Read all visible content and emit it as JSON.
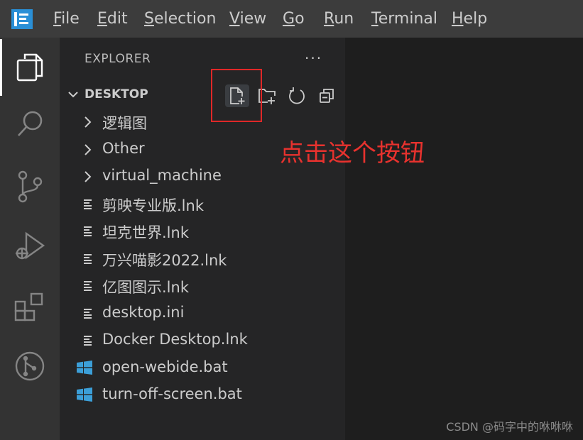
{
  "titlebar": {
    "app_icon": "vscode-icon",
    "menu": [
      {
        "label": "File",
        "access": "F",
        "rest": "ile"
      },
      {
        "label": "Edit",
        "access": "E",
        "rest": "dit"
      },
      {
        "label": "Selection",
        "access": "S",
        "rest": "election"
      },
      {
        "label": "View",
        "access": "V",
        "rest": "iew"
      },
      {
        "label": "Go",
        "access": "G",
        "rest": "o"
      },
      {
        "label": "Run",
        "access": "R",
        "rest": "un"
      },
      {
        "label": "Terminal",
        "access": "T",
        "rest": "erminal"
      },
      {
        "label": "Help",
        "access": "H",
        "rest": "elp"
      }
    ]
  },
  "activitybar": {
    "items": [
      "explorer-icon",
      "search-icon",
      "source-control-icon",
      "run-debug-icon",
      "extensions-icon",
      "remote-icon"
    ]
  },
  "explorer": {
    "title": "EXPLORER",
    "more": "···",
    "folder": "DESKTOP",
    "toolbar": [
      "new-file-icon",
      "new-folder-icon",
      "refresh-icon",
      "collapse-all-icon"
    ],
    "items": [
      {
        "type": "folder",
        "label": "逻辑图"
      },
      {
        "type": "folder",
        "label": "Other"
      },
      {
        "type": "folder",
        "label": "virtual_machine"
      },
      {
        "type": "file",
        "label": "剪映专业版.lnk"
      },
      {
        "type": "file",
        "label": "坦克世界.lnk"
      },
      {
        "type": "file",
        "label": "万兴喵影2022.lnk"
      },
      {
        "type": "file",
        "label": "亿图图示.lnk"
      },
      {
        "type": "file",
        "label": "desktop.ini"
      },
      {
        "type": "file",
        "label": "Docker Desktop.lnk"
      },
      {
        "type": "bat",
        "label": "open-webide.bat"
      },
      {
        "type": "bat",
        "label": "turn-off-screen.bat"
      }
    ]
  },
  "annotation": "点击这个按钮",
  "watermark": "CSDN @码字中的咻咻咻",
  "colors": {
    "highlight": "#e02828",
    "annotation": "#e8322e",
    "accent": "#0078d4"
  }
}
